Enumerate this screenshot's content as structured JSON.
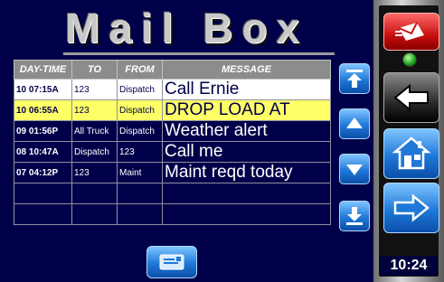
{
  "header": {
    "title": "Mail Box"
  },
  "table": {
    "columns": [
      "DAY-TIME",
      "TO",
      "FROM",
      "MESSAGE"
    ],
    "rows": [
      {
        "daytime": "10 07:15A",
        "to": "123",
        "from": "Dispatch",
        "message": "Call Ernie",
        "state": "selected"
      },
      {
        "daytime": "10 06:55A",
        "to": "123",
        "from": "Dispatch",
        "message": "DROP LOAD AT",
        "state": "highlight"
      },
      {
        "daytime": "09 01:56P",
        "to": "All Truck",
        "from": "Dispatch",
        "message": "Weather alert",
        "state": "normal"
      },
      {
        "daytime": "08 10:47A",
        "to": "Dispatch",
        "from": "123",
        "message": "Call me",
        "state": "normal"
      },
      {
        "daytime": "07 04:12P",
        "to": "123",
        "from": "Maint",
        "message": "Maint reqd today",
        "state": "normal"
      },
      {
        "daytime": "",
        "to": "",
        "from": "",
        "message": "",
        "state": "empty"
      },
      {
        "daytime": "",
        "to": "",
        "from": "",
        "message": "",
        "state": "empty"
      }
    ]
  },
  "scroll_buttons": [
    "scroll-top-icon",
    "scroll-up-icon",
    "scroll-down-icon",
    "scroll-bottom-icon"
  ],
  "compose_button": {
    "icon": "compose-message-icon"
  },
  "side_panel": {
    "mail_icon": "red-mail-icon",
    "back_icon": "back-arrow-icon",
    "home_icon": "home-icon",
    "forward_icon": "forward-arrow-icon",
    "status_led_color": "#1a9e1a",
    "clock": "10:24"
  },
  "colors": {
    "background": "#00004a",
    "highlight": "#ffff66",
    "button_blue": "#1f78d8",
    "mail_red": "#d02020"
  }
}
